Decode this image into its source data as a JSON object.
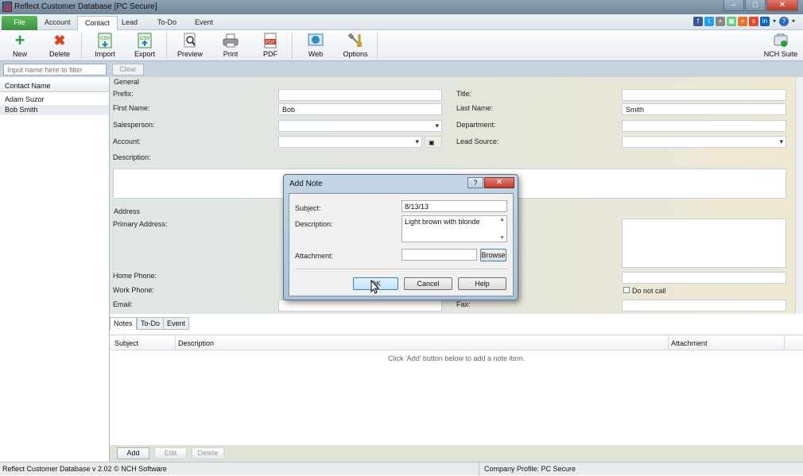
{
  "window": {
    "title": "Reflect Customer Database [PC Secure]"
  },
  "menu": {
    "tabs": [
      "File",
      "Account",
      "Contact",
      "Lead",
      "To-Do",
      "Event"
    ],
    "active": "Contact"
  },
  "toolbar": {
    "new": "New",
    "delete": "Delete",
    "import": "Import",
    "export": "Export",
    "preview": "Preview",
    "print": "Print",
    "pdf": "PDF",
    "web": "Web",
    "options": "Options",
    "nch_suite": "NCH Suite"
  },
  "sidebar": {
    "filter_placeholder": "Input name here to filter",
    "clear": "Clear",
    "column_header": "Contact Name",
    "contacts": [
      "Adam Suzor",
      "Bob Smith"
    ]
  },
  "form": {
    "general_label": "General",
    "prefix_label": "Prefix:",
    "prefix_value": "",
    "title_label": "Title:",
    "title_value": "",
    "first_name_label": "First Name:",
    "first_name_value": "Bob",
    "last_name_label": "Last Name:",
    "last_name_value": "Smith",
    "salesperson_label": "Salesperson:",
    "department_label": "Department:",
    "account_label": "Account:",
    "lead_source_label": "Lead Source:",
    "description_label": "Description:",
    "address_label": "Address",
    "primary_address_label": "Primary Address:",
    "home_phone_label": "Home Phone:",
    "work_phone_label": "Work Phone:",
    "email_label": "Email:",
    "fax_label": "Fax:",
    "do_not_call_label": "Do not call"
  },
  "bottom_tabs": [
    "Notes",
    "To-Do",
    "Event"
  ],
  "notes": {
    "columns": [
      "Subject",
      "Description",
      "Attachment"
    ],
    "empty_message": "Click 'Add' button below to add a note item.",
    "add": "Add",
    "edit": "Edit",
    "delete": "Delete"
  },
  "dialog": {
    "title": "Add Note",
    "subject_label": "Subject:",
    "subject_value": "8/13/13",
    "description_label": "Description:",
    "description_value": "Light brown with blonde",
    "attachment_label": "Attachment:",
    "attachment_value": "",
    "browse": "Browse",
    "ok": "OK",
    "cancel": "Cancel",
    "help": "Help"
  },
  "status": {
    "left": "Reflect Customer Database v 2.02 © NCH Software",
    "right": "Company Profile: PC Secure"
  },
  "colors": {
    "file_tab": "#4caf50",
    "close_red": "#c0392b",
    "form_bg": "#e3e6dd"
  }
}
